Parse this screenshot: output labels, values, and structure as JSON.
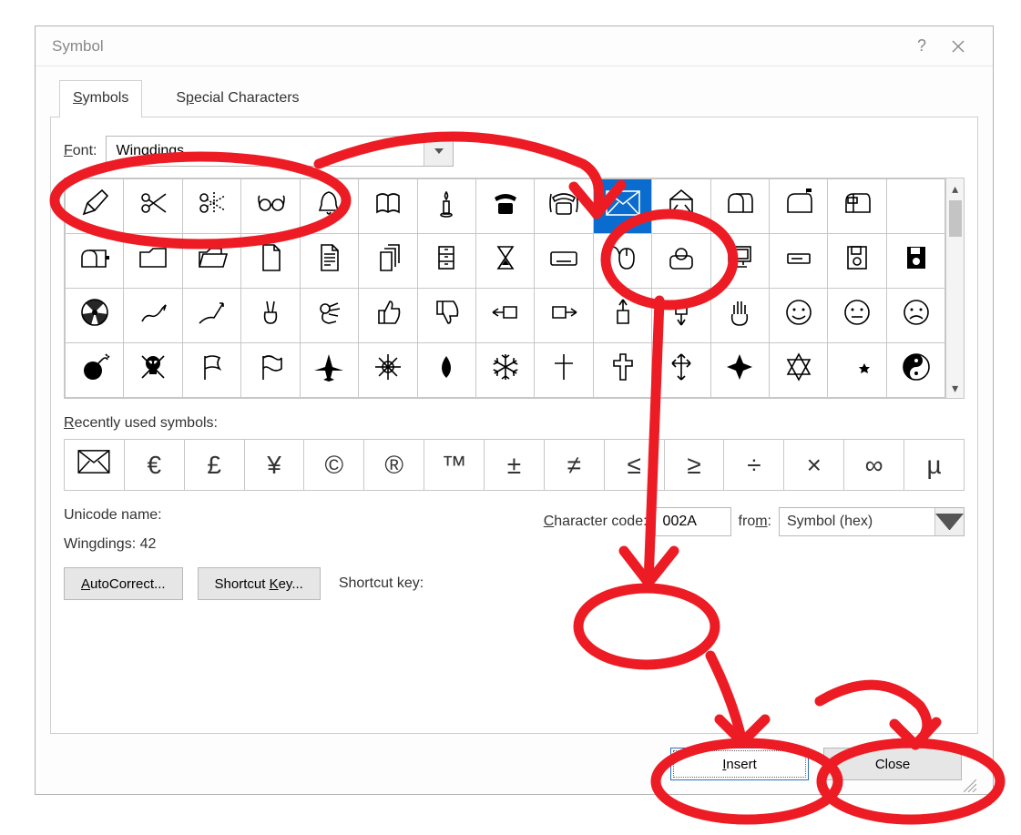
{
  "window": {
    "title": "Symbol",
    "help_tooltip": "?",
    "close_tooltip": "Close"
  },
  "tabs": {
    "symbols": "Symbols",
    "special": "Special Characters"
  },
  "font": {
    "label": "Font:",
    "value": "Wingdings"
  },
  "grid": {
    "rows": [
      [
        "pencil",
        "scissors",
        "scissors-cut",
        "glasses",
        "bell",
        "book",
        "candle",
        "phone",
        "phone-ring",
        "envelope",
        "envelope-open",
        "mailbox",
        "mailbox-flag",
        "mailbox-open"
      ],
      [
        "mailbox-down",
        "folder",
        "folder-open",
        "page",
        "page-text",
        "pages",
        "cabinet",
        "hourglass",
        "keyboard",
        "mouse",
        "trackball",
        "computer",
        "drive",
        "floppy",
        "floppy-black"
      ],
      [
        "radiation",
        "hand-write",
        "hand-write2",
        "hand-peace",
        "hand-ok",
        "thumbs-up",
        "thumbs-down",
        "point-left",
        "point-right",
        "point-up",
        "point-down",
        "hand-stop",
        "smiley",
        "neutral",
        "frown"
      ],
      [
        "bomb",
        "skull",
        "flag",
        "flag-wave",
        "airplane",
        "sun",
        "droplet",
        "snowflake",
        "cross",
        "cross-bold",
        "cross-arrow",
        "maltese",
        "star-david",
        "crescent",
        "yinyang"
      ]
    ],
    "selected": {
      "row": 0,
      "col": 9,
      "name": "envelope"
    }
  },
  "recent": {
    "label": "Recently used symbols:",
    "items": [
      "✉",
      "€",
      "£",
      "¥",
      "©",
      "®",
      "™",
      "±",
      "≠",
      "≤",
      "≥",
      "÷",
      "×",
      "∞",
      "µ"
    ]
  },
  "info": {
    "unicode_name_label": "Unicode name:",
    "unicode_name": "Wingdings: 42",
    "charcode_label": "Character code:",
    "charcode": "002A",
    "from_label": "from:",
    "from_value": "Symbol (hex)"
  },
  "buttons": {
    "autocorrect": "AutoCorrect...",
    "shortcutkey_btn": "Shortcut Key...",
    "shortcutkey_label": "Shortcut key:",
    "insert": "Insert",
    "close": "Close"
  }
}
